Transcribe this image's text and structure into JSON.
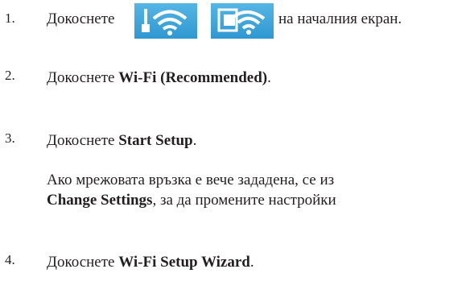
{
  "steps": [
    {
      "num": "1.",
      "before": "Докоснете",
      "after": "на началния екран."
    },
    {
      "num": "2.",
      "before": "Докоснете",
      "bold": "Wi-Fi (Recommended)",
      "after": "."
    },
    {
      "num": "3.",
      "before": "Докоснете",
      "bold": "Start Setup",
      "after": "."
    },
    {
      "line1": "Ако мрежовата връзка е вече зададена, се из",
      "bold": "Change Settings",
      "after": ", за да промените настройки"
    },
    {
      "num": "4.",
      "before": "Докоснете",
      "bold": "Wi-Fi Setup Wizard",
      "after": "."
    }
  ],
  "icons": [
    "wifi-router-icon",
    "wifi-direct-icon"
  ],
  "colors": {
    "text": "#231f20",
    "icon_tile": "#3aa3dc"
  }
}
